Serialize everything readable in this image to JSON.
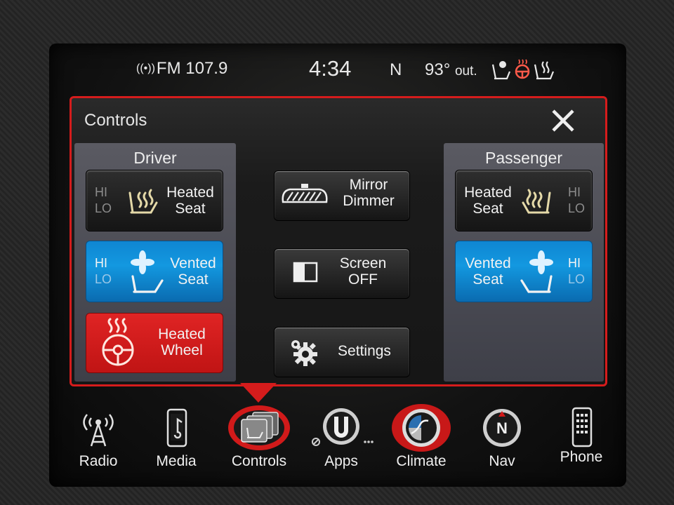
{
  "status_bar": {
    "radio": "FM 107.9",
    "time": "4:34",
    "compass": "N",
    "temperature": "93°",
    "temperature_unit": "out.",
    "icons": [
      "vented-seat-icon",
      "heated-wheel-icon",
      "heated-seat-icon"
    ]
  },
  "panel": {
    "title": "Controls",
    "close_icon": "close-icon",
    "driver": {
      "heading": "Driver",
      "heated_seat": {
        "label_line1": "Heated",
        "label_line2": "Seat",
        "hi": "HI",
        "lo": "LO",
        "active_level": "none"
      },
      "vented_seat": {
        "label_line1": "Vented",
        "label_line2": "Seat",
        "hi": "HI",
        "lo": "LO",
        "active_level": "HI"
      },
      "heated_wheel": {
        "label_line1": "Heated",
        "label_line2": "Wheel",
        "state": "on"
      }
    },
    "center": {
      "mirror_dimmer": {
        "label_line1": "Mirror",
        "label_line2": "Dimmer"
      },
      "screen_off": {
        "label_line1": "Screen",
        "label_line2": "OFF"
      },
      "settings": {
        "label": "Settings"
      }
    },
    "passenger": {
      "heading": "Passenger",
      "heated_seat": {
        "label_line1": "Heated",
        "label_line2": "Seat",
        "hi": "HI",
        "lo": "LO",
        "active_level": "none"
      },
      "vented_seat": {
        "label_line1": "Vented",
        "label_line2": "Seat",
        "hi": "HI",
        "lo": "LO",
        "active_level": "HI"
      }
    }
  },
  "nav": {
    "items": [
      {
        "label": "Radio",
        "icon": "radio-tower-icon",
        "active": false
      },
      {
        "label": "Media",
        "icon": "media-device-icon",
        "active": false
      },
      {
        "label": "Controls",
        "icon": "controls-icon",
        "active": true
      },
      {
        "label": "Apps",
        "icon": "apps-icon",
        "active": false
      },
      {
        "label": "Climate",
        "icon": "climate-icon",
        "active": false
      },
      {
        "label": "Nav",
        "icon": "compass-icon",
        "active": false
      },
      {
        "label": "Phone",
        "icon": "phone-icon",
        "active": false
      }
    ]
  },
  "colors": {
    "accent_red": "#d51c1c",
    "active_blue": "#1398e0",
    "heated_red": "#c01414"
  }
}
